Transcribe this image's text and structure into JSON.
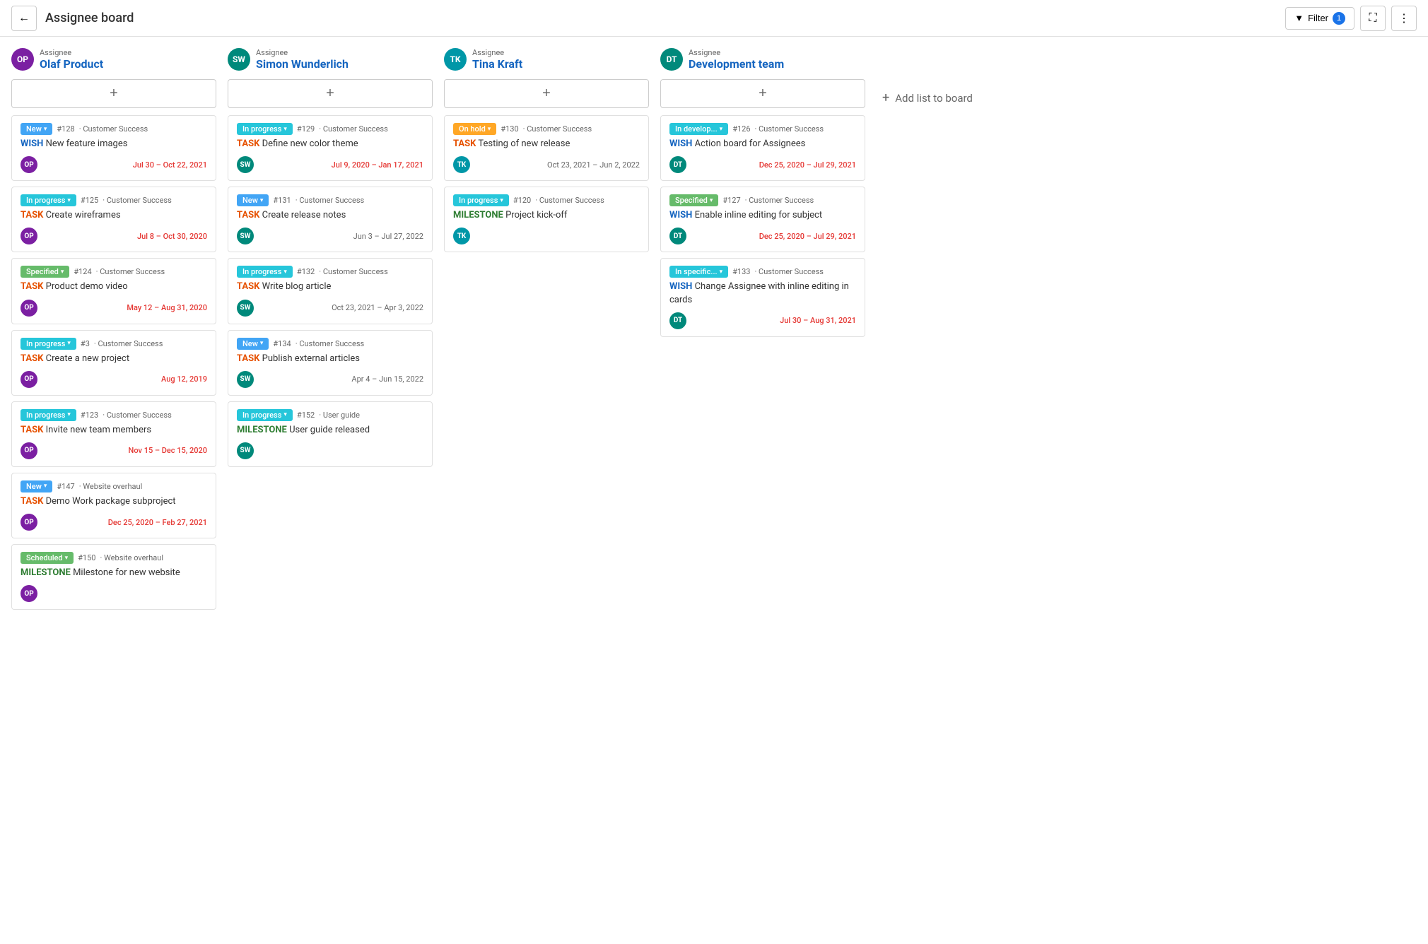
{
  "header": {
    "back_label": "←",
    "title": "Assignee board",
    "filter_label": "Filter",
    "filter_count": "1",
    "fullscreen_icon": "⛶",
    "more_icon": "⋮"
  },
  "add_list_label": "Add list to board",
  "columns": [
    {
      "id": "olaf",
      "assignee_label": "Assignee",
      "assignee_name": "Olaf Product",
      "avatar_initials": "OP",
      "avatar_color": "#7b1fa2",
      "cards": [
        {
          "status": "New",
          "status_class": "status-new",
          "number": "#128",
          "project": "Customer Success",
          "type": "WISH",
          "type_class": "type-wish",
          "title": "New feature images",
          "avatar_initials": "OP",
          "avatar_color": "#7b1fa2",
          "dates": "Jul 30 – Oct 22, 2021",
          "dates_class": "dates-overdue"
        },
        {
          "status": "In progress",
          "status_class": "status-inprogress",
          "number": "#125",
          "project": "Customer Success",
          "type": "TASK",
          "type_class": "type-task",
          "title": "Create wireframes",
          "avatar_initials": "OP",
          "avatar_color": "#7b1fa2",
          "dates": "Jul 8 – Oct 30, 2020",
          "dates_class": "dates-overdue"
        },
        {
          "status": "Specified",
          "status_class": "status-specified",
          "number": "#124",
          "project": "Customer Success",
          "type": "TASK",
          "type_class": "type-task",
          "title": "Product demo video",
          "avatar_initials": "OP",
          "avatar_color": "#7b1fa2",
          "dates": "May 12 – Aug 31, 2020",
          "dates_class": "dates-overdue"
        },
        {
          "status": "In progress",
          "status_class": "status-inprogress",
          "number": "#3",
          "project": "Customer Success",
          "type": "TASK",
          "type_class": "type-task",
          "title": "Create a new project",
          "avatar_initials": "OP",
          "avatar_color": "#7b1fa2",
          "dates": "Aug 12, 2019",
          "dates_class": "dates-overdue"
        },
        {
          "status": "In progress",
          "status_class": "status-inprogress",
          "number": "#123",
          "project": "Customer Success",
          "type": "TASK",
          "type_class": "type-task",
          "title": "Invite new team members",
          "avatar_initials": "OP",
          "avatar_color": "#7b1fa2",
          "dates": "Nov 15 – Dec 15, 2020",
          "dates_class": "dates-overdue"
        },
        {
          "status": "New",
          "status_class": "status-new",
          "number": "#147",
          "project": "Website overhaul",
          "type": "TASK",
          "type_class": "type-task",
          "title": "Demo Work package subproject",
          "avatar_initials": "OP",
          "avatar_color": "#7b1fa2",
          "dates": "Dec 25, 2020 – Feb 27, 2021",
          "dates_class": "dates-overdue"
        },
        {
          "status": "Scheduled",
          "status_class": "status-scheduled",
          "number": "#150",
          "project": "Website overhaul",
          "type": "MILESTONE",
          "type_class": "type-milestone",
          "title": "Milestone for new website",
          "avatar_initials": "OP",
          "avatar_color": "#7b1fa2",
          "dates": "",
          "dates_class": "dates-normal"
        }
      ]
    },
    {
      "id": "simon",
      "assignee_label": "Assignee",
      "assignee_name": "Simon Wunderlich",
      "avatar_initials": "SW",
      "avatar_color": "#00897b",
      "cards": [
        {
          "status": "In progress",
          "status_class": "status-inprogress",
          "number": "#129",
          "project": "Customer Success",
          "type": "TASK",
          "type_class": "type-task",
          "title": "Define new color theme",
          "avatar_initials": "SW",
          "avatar_color": "#00897b",
          "dates": "Jul 9, 2020 – Jan 17, 2021",
          "dates_class": "dates-overdue"
        },
        {
          "status": "New",
          "status_class": "status-new",
          "number": "#131",
          "project": "Customer Success",
          "type": "TASK",
          "type_class": "type-task",
          "title": "Create release notes",
          "avatar_initials": "SW",
          "avatar_color": "#00897b",
          "dates": "Jun 3 – Jul 27, 2022",
          "dates_class": "dates-normal"
        },
        {
          "status": "In progress",
          "status_class": "status-inprogress",
          "number": "#132",
          "project": "Customer Success",
          "type": "TASK",
          "type_class": "type-task",
          "title": "Write blog article",
          "avatar_initials": "SW",
          "avatar_color": "#00897b",
          "dates": "Oct 23, 2021 – Apr 3, 2022",
          "dates_class": "dates-normal"
        },
        {
          "status": "New",
          "status_class": "status-new",
          "number": "#134",
          "project": "Customer Success",
          "type": "TASK",
          "type_class": "type-task",
          "title": "Publish external articles",
          "avatar_initials": "SW",
          "avatar_color": "#00897b",
          "dates": "Apr 4 – Jun 15, 2022",
          "dates_class": "dates-normal"
        },
        {
          "status": "In progress",
          "status_class": "status-inprogress",
          "number": "#152",
          "project": "User guide",
          "type": "MILESTONE",
          "type_class": "type-milestone",
          "title": "User guide released",
          "avatar_initials": "SW",
          "avatar_color": "#00897b",
          "dates": "",
          "dates_class": "dates-normal"
        }
      ]
    },
    {
      "id": "tina",
      "assignee_label": "Assignee",
      "assignee_name": "Tina Kraft",
      "avatar_initials": "TK",
      "avatar_color": "#0097a7",
      "cards": [
        {
          "status": "On hold",
          "status_class": "status-onhold",
          "number": "#130",
          "project": "Customer Success",
          "type": "TASK",
          "type_class": "type-task",
          "title": "Testing of new release",
          "avatar_initials": "TK",
          "avatar_color": "#0097a7",
          "dates": "Oct 23, 2021 – Jun 2, 2022",
          "dates_class": "dates-normal"
        },
        {
          "status": "In progress",
          "status_class": "status-inprogress",
          "number": "#120",
          "project": "Customer Success",
          "type": "MILESTONE",
          "type_class": "type-milestone",
          "title": "Project kick-off",
          "avatar_initials": "TK",
          "avatar_color": "#0097a7",
          "dates": "",
          "dates_class": "dates-normal"
        }
      ]
    },
    {
      "id": "devteam",
      "assignee_label": "Assignee",
      "assignee_name": "Development team",
      "avatar_initials": "DT",
      "avatar_color": "#00897b",
      "cards": [
        {
          "status": "In develop...",
          "status_class": "status-indevelop",
          "number": "#126",
          "project": "Customer Success",
          "type": "WISH",
          "type_class": "type-wish",
          "title": "Action board for Assignees",
          "avatar_initials": "DT",
          "avatar_color": "#00897b",
          "dates": "Dec 25, 2020 – Jul 29, 2021",
          "dates_class": "dates-overdue"
        },
        {
          "status": "Specified",
          "status_class": "status-specified",
          "number": "#127",
          "project": "Customer Success",
          "type": "WISH",
          "type_class": "type-wish",
          "title": "Enable inline editing for subject",
          "avatar_initials": "DT",
          "avatar_color": "#00897b",
          "dates": "Dec 25, 2020 – Jul 29, 2021",
          "dates_class": "dates-overdue"
        },
        {
          "status": "In specific...",
          "status_class": "status-inspecific",
          "number": "#133",
          "project": "Customer Success",
          "type": "WISH",
          "type_class": "type-wish",
          "title": "Change Assignee with inline editing in cards",
          "avatar_initials": "DT",
          "avatar_color": "#00897b",
          "dates": "Jul 30 – Aug 31, 2021",
          "dates_class": "dates-overdue"
        }
      ]
    }
  ]
}
